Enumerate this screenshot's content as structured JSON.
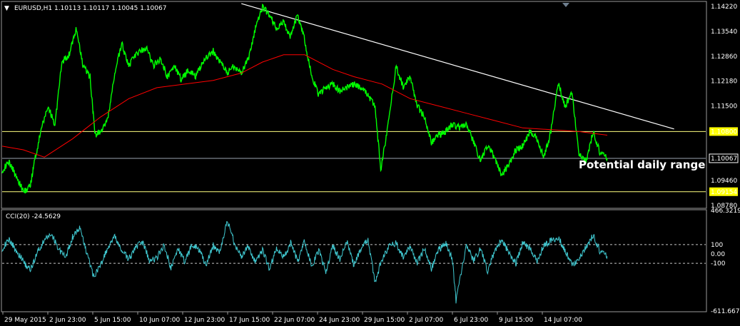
{
  "header": {
    "menu_glyph": "▼",
    "symbol_info": "EURUSD,H1  1.10113 1.10117 1.10045 1.10067",
    "indicator_info": "CCI(20) -24.5629"
  },
  "annotation": "Potential daily range",
  "colors": {
    "background": "#000000",
    "price": "#00ff00",
    "ma": "#ff0000",
    "cci": "#40c8d0",
    "levels": "#ffff80",
    "trendline": "#ffffff",
    "highlight": "#ffff00"
  },
  "chart_data": [
    {
      "type": "line",
      "panel": "price",
      "y_ticks": [
        "1.14220",
        "1.13540",
        "1.12860",
        "1.12180",
        "1.11500",
        "1.10800",
        "1.10067",
        "1.09460",
        "1.09154",
        "1.08780"
      ],
      "y_tick_values": [
        1.1422,
        1.1354,
        1.1286,
        1.1218,
        1.115,
        1.108,
        1.10067,
        1.0946,
        1.09154,
        1.0878
      ],
      "highlighted_ticks": [
        "1.10800",
        "1.09154"
      ],
      "current_price": 1.10067,
      "ylim": [
        1.0872,
        1.1434
      ],
      "x_ticks": [
        "29 May 2015",
        "2 Jun 23:00",
        "5 Jun 15:00",
        "10 Jun 07:00",
        "12 Jun 23:00",
        "17 Jun 15:00",
        "22 Jun 07:00",
        "24 Jun 23:00",
        "29 Jun 15:00",
        "2 Jul 07:00",
        "6 Jul 23:00",
        "9 Jul 15:00",
        "14 Jul 07:00"
      ],
      "horizontal_levels": [
        1.108,
        1.10067,
        1.09154
      ],
      "trendline": {
        "from": [
          0.0,
          1.143
        ],
        "to": [
          1.0,
          1.1087
        ]
      },
      "price_points": [
        [
          0.0,
          1.0975
        ],
        [
          0.01,
          1.0995
        ],
        [
          0.02,
          1.096
        ],
        [
          0.03,
          1.0915
        ],
        [
          0.04,
          1.093
        ],
        [
          0.045,
          1.099
        ],
        [
          0.055,
          1.108
        ],
        [
          0.065,
          1.115
        ],
        [
          0.075,
          1.11
        ],
        [
          0.085,
          1.127
        ],
        [
          0.095,
          1.129
        ],
        [
          0.105,
          1.136
        ],
        [
          0.115,
          1.126
        ],
        [
          0.125,
          1.123
        ],
        [
          0.132,
          1.107
        ],
        [
          0.14,
          1.108
        ],
        [
          0.15,
          1.111
        ],
        [
          0.16,
          1.124
        ],
        [
          0.17,
          1.132
        ],
        [
          0.18,
          1.126
        ],
        [
          0.19,
          1.129
        ],
        [
          0.205,
          1.131
        ],
        [
          0.215,
          1.126
        ],
        [
          0.225,
          1.128
        ],
        [
          0.235,
          1.123
        ],
        [
          0.245,
          1.126
        ],
        [
          0.255,
          1.122
        ],
        [
          0.265,
          1.125
        ],
        [
          0.275,
          1.123
        ],
        [
          0.285,
          1.127
        ],
        [
          0.3,
          1.13
        ],
        [
          0.31,
          1.127
        ],
        [
          0.32,
          1.124
        ],
        [
          0.33,
          1.126
        ],
        [
          0.34,
          1.124
        ],
        [
          0.35,
          1.128
        ],
        [
          0.36,
          1.136
        ],
        [
          0.37,
          1.142
        ],
        [
          0.38,
          1.14
        ],
        [
          0.39,
          1.136
        ],
        [
          0.4,
          1.138
        ],
        [
          0.41,
          1.134
        ],
        [
          0.42,
          1.14
        ],
        [
          0.43,
          1.133
        ],
        [
          0.44,
          1.123
        ],
        [
          0.45,
          1.118
        ],
        [
          0.46,
          1.12
        ],
        [
          0.47,
          1.121
        ],
        [
          0.48,
          1.119
        ],
        [
          0.49,
          1.12
        ],
        [
          0.5,
          1.121
        ],
        [
          0.51,
          1.12
        ],
        [
          0.52,
          1.118
        ],
        [
          0.53,
          1.115
        ],
        [
          0.538,
          1.0975
        ],
        [
          0.548,
          1.109
        ],
        [
          0.56,
          1.126
        ],
        [
          0.57,
          1.12
        ],
        [
          0.58,
          1.123
        ],
        [
          0.59,
          1.115
        ],
        [
          0.6,
          1.112
        ],
        [
          0.61,
          1.105
        ],
        [
          0.62,
          1.107
        ],
        [
          0.63,
          1.108
        ],
        [
          0.64,
          1.11
        ],
        [
          0.65,
          1.109
        ],
        [
          0.66,
          1.11
        ],
        [
          0.67,
          1.105
        ],
        [
          0.68,
          1.1
        ],
        [
          0.69,
          1.104
        ],
        [
          0.7,
          1.101
        ],
        [
          0.71,
          1.096
        ],
        [
          0.72,
          1.099
        ],
        [
          0.73,
          1.103
        ],
        [
          0.74,
          1.104
        ],
        [
          0.75,
          1.108
        ],
        [
          0.76,
          1.106
        ],
        [
          0.77,
          1.101
        ],
        [
          0.78,
          1.108
        ],
        [
          0.79,
          1.1215
        ],
        [
          0.8,
          1.115
        ],
        [
          0.81,
          1.1185
        ],
        [
          0.82,
          1.102
        ],
        [
          0.83,
          1.1
        ],
        [
          0.84,
          1.108
        ],
        [
          0.85,
          1.102
        ],
        [
          0.86,
          1.1007
        ]
      ],
      "ma_points": [
        [
          0.0,
          1.104
        ],
        [
          0.03,
          1.103
        ],
        [
          0.06,
          1.101
        ],
        [
          0.1,
          1.106
        ],
        [
          0.14,
          1.112
        ],
        [
          0.18,
          1.117
        ],
        [
          0.22,
          1.12
        ],
        [
          0.26,
          1.121
        ],
        [
          0.3,
          1.122
        ],
        [
          0.34,
          1.124
        ],
        [
          0.37,
          1.127
        ],
        [
          0.4,
          1.129
        ],
        [
          0.43,
          1.129
        ],
        [
          0.47,
          1.125
        ],
        [
          0.5,
          1.123
        ],
        [
          0.54,
          1.121
        ],
        [
          0.58,
          1.117
        ],
        [
          0.62,
          1.115
        ],
        [
          0.66,
          1.113
        ],
        [
          0.7,
          1.111
        ],
        [
          0.74,
          1.109
        ],
        [
          0.78,
          1.1085
        ],
        [
          0.82,
          1.108
        ],
        [
          0.86,
          1.107
        ]
      ]
    },
    {
      "type": "line",
      "panel": "cci",
      "y_ticks": [
        "466.3219",
        "100",
        "0.00",
        "-100",
        "-611.6673"
      ],
      "y_tick_values": [
        466.3219,
        100,
        0,
        -100,
        -611.6673
      ],
      "ylim": [
        -611.6673,
        466.3219
      ],
      "levels": [
        100,
        -100
      ],
      "cci_points": [
        [
          0.0,
          60
        ],
        [
          0.01,
          150
        ],
        [
          0.02,
          40
        ],
        [
          0.03,
          -80
        ],
        [
          0.04,
          -180
        ],
        [
          0.05,
          20
        ],
        [
          0.06,
          140
        ],
        [
          0.07,
          220
        ],
        [
          0.08,
          60
        ],
        [
          0.09,
          -40
        ],
        [
          0.1,
          180
        ],
        [
          0.11,
          280
        ],
        [
          0.12,
          20
        ],
        [
          0.13,
          -240
        ],
        [
          0.14,
          -120
        ],
        [
          0.15,
          60
        ],
        [
          0.16,
          180
        ],
        [
          0.17,
          40
        ],
        [
          0.18,
          -60
        ],
        [
          0.19,
          80
        ],
        [
          0.2,
          120
        ],
        [
          0.21,
          -80
        ],
        [
          0.22,
          -40
        ],
        [
          0.23,
          100
        ],
        [
          0.24,
          -150
        ],
        [
          0.25,
          60
        ],
        [
          0.26,
          -90
        ],
        [
          0.27,
          110
        ],
        [
          0.28,
          40
        ],
        [
          0.29,
          -120
        ],
        [
          0.3,
          90
        ],
        [
          0.31,
          20
        ],
        [
          0.32,
          360
        ],
        [
          0.33,
          120
        ],
        [
          0.34,
          -30
        ],
        [
          0.35,
          80
        ],
        [
          0.36,
          -100
        ],
        [
          0.37,
          40
        ],
        [
          0.38,
          -160
        ],
        [
          0.39,
          60
        ],
        [
          0.4,
          -40
        ],
        [
          0.41,
          120
        ],
        [
          0.42,
          -80
        ],
        [
          0.43,
          140
        ],
        [
          0.44,
          -140
        ],
        [
          0.45,
          40
        ],
        [
          0.46,
          -200
        ],
        [
          0.47,
          90
        ],
        [
          0.48,
          -60
        ],
        [
          0.49,
          130
        ],
        [
          0.5,
          -120
        ],
        [
          0.51,
          60
        ],
        [
          0.52,
          150
        ],
        [
          0.53,
          -300
        ],
        [
          0.54,
          -60
        ],
        [
          0.55,
          80
        ],
        [
          0.56,
          120
        ],
        [
          0.57,
          -40
        ],
        [
          0.58,
          80
        ],
        [
          0.59,
          -100
        ],
        [
          0.6,
          60
        ],
        [
          0.61,
          -160
        ],
        [
          0.62,
          40
        ],
        [
          0.63,
          120
        ],
        [
          0.64,
          -60
        ],
        [
          0.645,
          -500
        ],
        [
          0.66,
          100
        ],
        [
          0.67,
          -80
        ],
        [
          0.68,
          60
        ],
        [
          0.69,
          -200
        ],
        [
          0.7,
          40
        ],
        [
          0.71,
          150
        ],
        [
          0.72,
          20
        ],
        [
          0.73,
          -100
        ],
        [
          0.74,
          120
        ],
        [
          0.75,
          60
        ],
        [
          0.76,
          -80
        ],
        [
          0.77,
          90
        ],
        [
          0.78,
          140
        ],
        [
          0.79,
          180
        ],
        [
          0.8,
          40
        ],
        [
          0.81,
          -120
        ],
        [
          0.82,
          -40
        ],
        [
          0.83,
          80
        ],
        [
          0.84,
          200
        ],
        [
          0.85,
          20
        ],
        [
          0.86,
          -24.5629
        ]
      ]
    }
  ]
}
